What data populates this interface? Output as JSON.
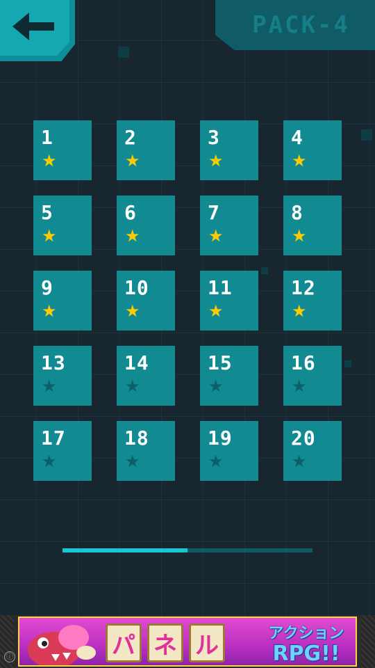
{
  "header": {
    "pack_title": "PACK-4"
  },
  "levels": [
    {
      "num": "1",
      "star": "★",
      "done": true
    },
    {
      "num": "2",
      "star": "★",
      "done": true
    },
    {
      "num": "3",
      "star": "★",
      "done": true
    },
    {
      "num": "4",
      "star": "★",
      "done": true
    },
    {
      "num": "5",
      "star": "★",
      "done": true
    },
    {
      "num": "6",
      "star": "★",
      "done": true
    },
    {
      "num": "7",
      "star": "★",
      "done": true
    },
    {
      "num": "8",
      "star": "★",
      "done": true
    },
    {
      "num": "9",
      "star": "★",
      "done": true
    },
    {
      "num": "10",
      "star": "★",
      "done": true
    },
    {
      "num": "11",
      "star": "★",
      "done": true
    },
    {
      "num": "12",
      "star": "★",
      "done": true
    },
    {
      "num": "13",
      "star": "★",
      "done": false
    },
    {
      "num": "14",
      "star": "★",
      "done": false
    },
    {
      "num": "15",
      "star": "★",
      "done": false
    },
    {
      "num": "16",
      "star": "★",
      "done": false
    },
    {
      "num": "17",
      "star": "★",
      "done": false
    },
    {
      "num": "18",
      "star": "★",
      "done": false
    },
    {
      "num": "19",
      "star": "★",
      "done": false
    },
    {
      "num": "20",
      "star": "★",
      "done": false
    }
  ],
  "progress": 0.5,
  "colors": {
    "star_earned": "#ffcb05",
    "star_empty": "#0b5f67",
    "tile": "#128a92",
    "accent": "#19c6d2"
  },
  "ad": {
    "blocks": [
      "パ",
      "ネ",
      "ル"
    ],
    "tagline_top": "アクション",
    "tagline_bottom": "RPG!!",
    "info_icon": "ⓘ"
  }
}
